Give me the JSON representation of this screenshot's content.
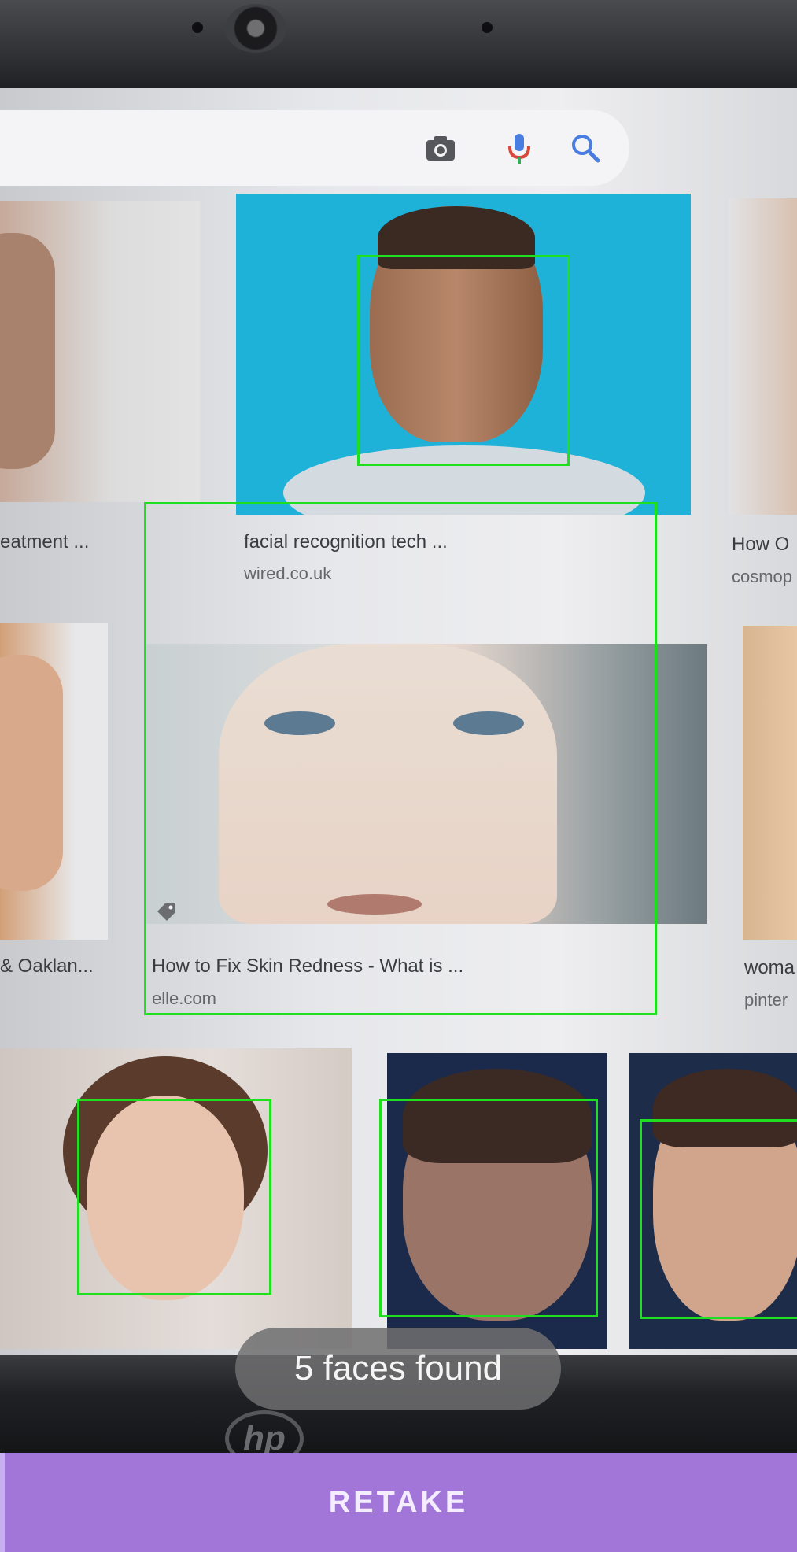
{
  "search_bar": {
    "icons": [
      "camera-icon",
      "microphone-icon",
      "search-icon"
    ],
    "colors": {
      "camera": "#55575c",
      "mic_blue": "#4a7de0",
      "mic_red": "#d9483b",
      "search": "#4a7de0"
    }
  },
  "results": [
    {
      "caption": "eatment ...",
      "source": ""
    },
    {
      "caption": "facial recognition tech ...",
      "source": "wired.co.uk"
    },
    {
      "caption": "How O",
      "source": "cosmop"
    },
    {
      "caption": "& Oaklan...",
      "source": ""
    },
    {
      "caption": "How to Fix Skin Redness - What is ...",
      "source": "elle.com"
    },
    {
      "caption": "woma",
      "source": "pinter"
    }
  ],
  "detection": {
    "face_count": 5,
    "box_color": "#1ee01e",
    "status_text": "5 faces found"
  },
  "actions": {
    "retake_label": "RETAKE",
    "button_color": "#a276d8"
  }
}
